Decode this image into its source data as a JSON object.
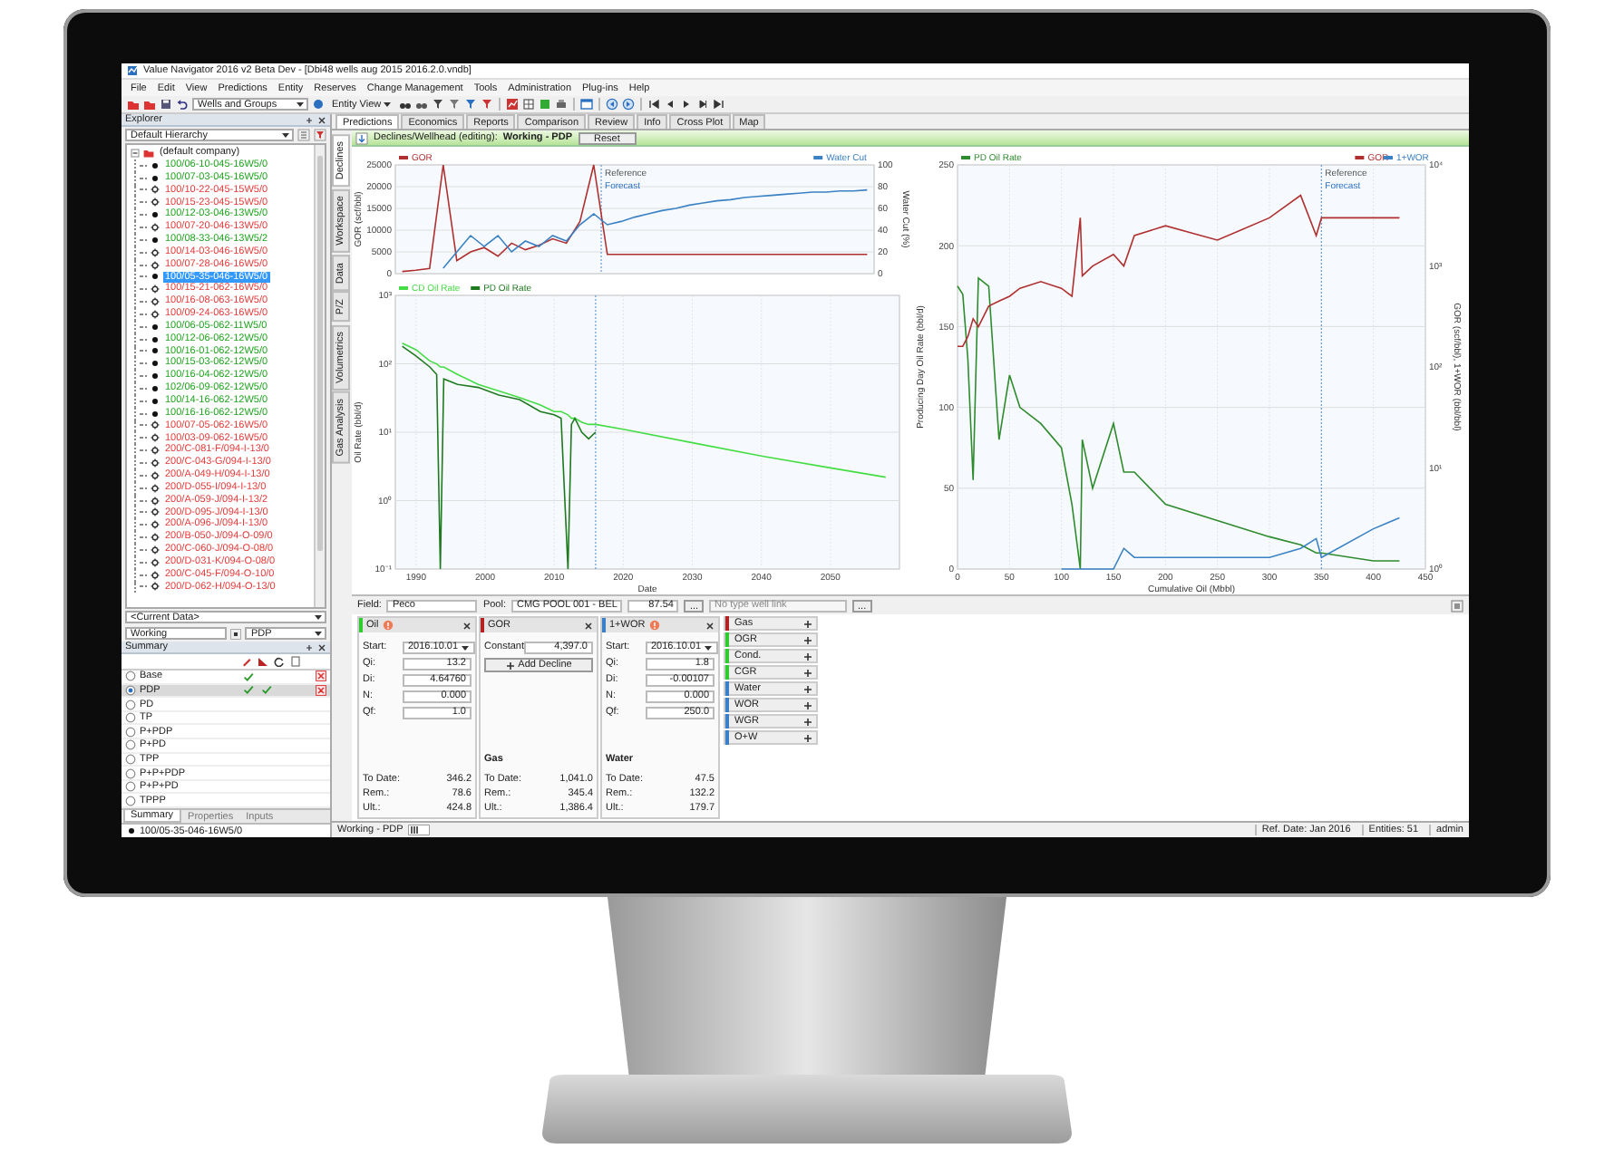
{
  "window": {
    "title": "Value Navigator 2016 v2 Beta Dev - [Dbi48 wells aug 2015 2016.2.0.vndb]"
  },
  "menu": [
    "File",
    "Edit",
    "View",
    "Predictions",
    "Entity",
    "Reserves",
    "Change Management",
    "Tools",
    "Administration",
    "Plug-ins",
    "Help"
  ],
  "toolbar": {
    "hierarchy_select": "Wells and Groups",
    "view_button": "Entity View"
  },
  "explorer": {
    "title": "Explorer",
    "hierarchy": "Default Hierarchy",
    "tree": [
      {
        "label": "(default company)",
        "expanded": true,
        "selected": false,
        "children": [
          {
            "label": "100/06-10-045-16W5/0",
            "kind": "dot",
            "color": "#1fa51f",
            "selected": false
          },
          {
            "label": "100/07-03-045-16W5/0",
            "kind": "dot",
            "color": "#1fa51f",
            "selected": false
          },
          {
            "label": "100/10-22-045-15W5/0",
            "kind": "gear",
            "color": "#e83a3a",
            "selected": false
          },
          {
            "label": "100/15-23-045-15W5/0",
            "kind": "gear",
            "color": "#e83a3a",
            "selected": false
          },
          {
            "label": "100/12-03-046-13W5/0",
            "kind": "dot",
            "color": "#1fa51f",
            "selected": false
          },
          {
            "label": "100/07-20-046-13W5/0",
            "kind": "gear",
            "color": "#e83a3a",
            "selected": false
          },
          {
            "label": "100/08-33-046-13W5/2",
            "kind": "dot",
            "color": "#1fa51f",
            "selected": false
          },
          {
            "label": "100/14-03-046-16W5/0",
            "kind": "gear",
            "color": "#e83a3a",
            "selected": false
          },
          {
            "label": "100/07-28-046-16W5/0",
            "kind": "gear",
            "color": "#e83a3a",
            "selected": false
          },
          {
            "label": "100/05-35-046-16W5/0",
            "kind": "dot",
            "selected": true
          },
          {
            "label": "100/15-21-062-16W5/0",
            "kind": "gear",
            "color": "#e83a3a",
            "selected": false
          },
          {
            "label": "100/16-08-063-16W5/0",
            "kind": "gear",
            "color": "#e83a3a",
            "selected": false
          },
          {
            "label": "100/09-24-063-16W5/0",
            "kind": "gear",
            "color": "#e83a3a",
            "selected": false
          },
          {
            "label": "100/06-05-062-11W5/0",
            "kind": "dot",
            "color": "#1fa51f",
            "selected": false
          },
          {
            "label": "100/12-06-062-12W5/0",
            "kind": "dot",
            "color": "#1fa51f",
            "selected": false
          },
          {
            "label": "100/16-01-062-12W5/0",
            "kind": "dot",
            "color": "#1fa51f",
            "selected": false
          },
          {
            "label": "100/15-03-062-12W5/0",
            "kind": "dot",
            "color": "#1fa51f",
            "selected": false
          },
          {
            "label": "100/16-04-062-12W5/0",
            "kind": "dot",
            "color": "#1fa51f",
            "selected": false
          },
          {
            "label": "102/06-09-062-12W5/0",
            "kind": "dot",
            "color": "#1fa51f",
            "selected": false
          },
          {
            "label": "100/14-16-062-12W5/0",
            "kind": "dot",
            "color": "#1fa51f",
            "selected": false
          },
          {
            "label": "100/16-16-062-12W5/0",
            "kind": "dot",
            "color": "#1fa51f",
            "selected": false
          },
          {
            "label": "100/07-05-062-16W5/0",
            "kind": "gear",
            "color": "#e83a3a",
            "selected": false
          },
          {
            "label": "100/03-09-062-16W5/0",
            "kind": "gear",
            "color": "#e83a3a",
            "selected": false
          },
          {
            "label": "200/C-081-F/094-I-13/0",
            "kind": "gear",
            "color": "#e83a3a",
            "selected": false
          },
          {
            "label": "200/C-043-G/094-I-13/0",
            "kind": "gear",
            "color": "#e83a3a",
            "selected": false
          },
          {
            "label": "200/A-049-H/094-I-13/0",
            "kind": "gear",
            "color": "#e83a3a",
            "selected": false
          },
          {
            "label": "200/D-055-I/094-I-13/0",
            "kind": "gear",
            "color": "#e83a3a",
            "selected": false
          },
          {
            "label": "200/A-059-J/094-I-13/2",
            "kind": "gear",
            "color": "#e83a3a",
            "selected": false
          },
          {
            "label": "200/D-095-J/094-I-13/0",
            "kind": "gear",
            "color": "#e83a3a",
            "selected": false
          },
          {
            "label": "200/A-096-J/094-I-13/0",
            "kind": "gear",
            "color": "#e83a3a",
            "selected": false
          },
          {
            "label": "200/B-050-J/094-O-09/0",
            "kind": "gear",
            "color": "#e83a3a",
            "selected": false
          },
          {
            "label": "200/C-060-J/094-O-08/0",
            "kind": "gear",
            "color": "#e83a3a",
            "selected": false
          },
          {
            "label": "200/D-031-K/094-O-08/0",
            "kind": "gear",
            "color": "#e83a3a",
            "selected": false
          },
          {
            "label": "200/C-045-F/094-O-10/0",
            "kind": "gear",
            "color": "#e83a3a",
            "selected": false
          },
          {
            "label": "200/D-062-H/094-O-13/0",
            "kind": "gear",
            "color": "#e83a3a",
            "selected": false
          }
        ]
      }
    ],
    "data_select": "<Current Data>",
    "scenario": "Working",
    "scenario_type": "PDP"
  },
  "summary": {
    "title": "Summary",
    "rows": [
      {
        "name": "Base",
        "selected": false,
        "check_1": true,
        "check_2": false,
        "removable": true
      },
      {
        "name": "PDP",
        "selected": true,
        "check_1": true,
        "check_2": true,
        "removable": true
      },
      {
        "name": "PD",
        "selected": false,
        "check_1": false,
        "check_2": false,
        "removable": false
      },
      {
        "name": "TP",
        "selected": false,
        "check_1": false,
        "check_2": false,
        "removable": false
      },
      {
        "name": "P+PDP",
        "selected": false,
        "check_1": false,
        "check_2": false,
        "removable": false
      },
      {
        "name": "P+PD",
        "selected": false,
        "check_1": false,
        "check_2": false,
        "removable": false
      },
      {
        "name": "TPP",
        "selected": false,
        "check_1": false,
        "check_2": false,
        "removable": false
      },
      {
        "name": "P+P+PDP",
        "selected": false,
        "check_1": false,
        "check_2": false,
        "removable": false
      },
      {
        "name": "P+P+PD",
        "selected": false,
        "check_1": false,
        "check_2": false,
        "removable": false
      },
      {
        "name": "TPPP",
        "selected": false,
        "check_1": false,
        "check_2": false,
        "removable": false
      }
    ],
    "tabs": [
      {
        "label": "Summary",
        "selected": true
      },
      {
        "label": "Properties",
        "selected": false
      },
      {
        "label": "Inputs",
        "selected": false
      }
    ],
    "entity": "100/05-35-046-16W5/0"
  },
  "main": {
    "tabs": [
      {
        "label": "Predictions",
        "selected": true
      },
      {
        "label": "Economics",
        "selected": false
      },
      {
        "label": "Reports",
        "selected": false
      },
      {
        "label": "Comparison",
        "selected": false
      },
      {
        "label": "Review",
        "selected": false
      },
      {
        "label": "Info",
        "selected": false
      },
      {
        "label": "Cross Plot",
        "selected": false
      },
      {
        "label": "Map",
        "selected": false
      }
    ],
    "side_tabs": [
      {
        "label": "Declines",
        "selected": true
      },
      {
        "label": "Workspace",
        "selected": false
      },
      {
        "label": "Data",
        "selected": false
      },
      {
        "label": "P/Z",
        "selected": false
      },
      {
        "label": "Volumetrics",
        "selected": false
      },
      {
        "label": "Gas Analysis",
        "selected": false
      }
    ],
    "edit_bar": {
      "label": "Declines/Wellhead (editing):",
      "scenario": "Working - PDP",
      "button": "Reset"
    },
    "charts": [
      {
        "chart_data": {
          "type": "line",
          "grid": true,
          "legend": "top",
          "ylabel": "GOR (scf/bbl)",
          "y2label": "Water Cut (%)",
          "ylim": [
            0,
            25000
          ],
          "yticks": [
            0,
            5000,
            10000,
            15000,
            20000,
            25000
          ],
          "y2lim": [
            0,
            100
          ],
          "y2ticks": [
            0,
            20,
            40,
            60,
            80,
            100
          ],
          "categories": [
            null,
            null,
            null,
            null,
            null,
            null,
            null,
            null,
            null,
            null,
            null,
            null,
            null,
            null,
            null,
            null,
            null,
            null,
            null,
            null,
            null,
            null,
            null,
            null,
            null,
            null,
            null,
            null,
            null,
            null,
            null,
            null,
            null,
            null,
            null
          ],
          "series": [
            {
              "name": "GOR",
              "color": "#b03030",
              "values": [
                500,
                800,
                1200,
                25000,
                3000,
                5000,
                6000,
                4000,
                7000,
                5500,
                6500,
                8000,
                7000,
                12000,
                25000,
                4400,
                4400,
                4400,
                4400,
                4400,
                4400,
                4400,
                4400,
                4400,
                4400,
                4400,
                4400,
                4400,
                4400,
                4400,
                4400,
                4400,
                4400,
                4400,
                4400
              ]
            },
            {
              "name": "Water Cut",
              "color": "#3b82c4",
              "axis": "y2",
              "values": [
                null,
                null,
                null,
                5,
                20,
                35,
                25,
                35,
                20,
                30,
                25,
                35,
                30,
                45,
                55,
                45,
                48,
                52,
                55,
                58,
                60,
                63,
                65,
                67,
                68,
                70,
                71,
                72,
                73,
                74,
                75,
                75,
                76,
                76,
                77
              ]
            }
          ],
          "annotations": [
            "Reference",
            "Forecast"
          ]
        }
      },
      {
        "chart_data": {
          "type": "line",
          "grid": true,
          "legend": "top",
          "log": "y",
          "xlabel": "Date",
          "ylabel": "Oil Rate (bbl/d)",
          "xlim": [
            1987,
            2060
          ],
          "ylim": [
            0.1,
            1000
          ],
          "xticks": [
            1990,
            2000,
            2010,
            2020,
            2030,
            2040,
            2050
          ],
          "yticks": [
            {
              "value": 0.1,
              "label": "10⁻¹"
            },
            {
              "value": 1,
              "label": "10⁰"
            },
            {
              "value": 10,
              "label": "10¹"
            },
            {
              "value": 100,
              "label": "10²"
            },
            {
              "value": 1000,
              "label": "10³"
            }
          ],
          "x": [
            1988,
            1990,
            1992,
            1993,
            1993.5,
            1994,
            1996,
            1999,
            2002,
            2005,
            2008,
            2010,
            2011,
            2012,
            2012.5,
            2013,
            2014,
            2015,
            2016,
            2020,
            2030,
            2040,
            2050,
            2058
          ],
          "series": [
            {
              "name": "CD Oil Rate",
              "color": "#44dd44",
              "values": [
                200,
                160,
                110,
                100,
                90,
                90,
                70,
                50,
                40,
                32,
                25,
                20,
                20,
                18,
                16,
                16,
                14,
                13,
                13,
                11,
                7,
                4.5,
                3,
                2.2
              ]
            },
            {
              "name": "PD Oil Rate",
              "color": "#1f7a1f",
              "values": [
                180,
                130,
                90,
                70,
                0.1,
                60,
                50,
                45,
                35,
                30,
                20,
                18,
                16,
                0.1,
                13,
                16,
                10,
                8,
                10,
                null,
                null,
                null,
                null,
                null
              ]
            }
          ],
          "ref_lines": [
            {
              "axis": "x",
              "value": 2016
            }
          ]
        }
      },
      {
        "chart_data": {
          "type": "line",
          "grid": true,
          "legend": "top",
          "log": "y2",
          "xlabel": "Cumulative Oil (Mbbl)",
          "ylabel": "Producing Day Oil Rate (bbl/d)",
          "y2label": "GOR (scf/bbl), 1+WOR (bbl/bbl)",
          "xlim": [
            0,
            450
          ],
          "ylim": [
            0,
            250
          ],
          "xticks": [
            0,
            50,
            100,
            150,
            200,
            250,
            300,
            350,
            400,
            450
          ],
          "yticks": [
            0,
            50,
            100,
            150,
            200,
            250
          ],
          "y2lim": [
            1,
            10000
          ],
          "y2ticks": [
            {
              "value": 1,
              "label": "10⁰"
            },
            {
              "value": 10,
              "label": "10¹"
            },
            {
              "value": 100,
              "label": "10²"
            },
            {
              "value": 1000,
              "label": "10³"
            },
            {
              "value": 10000,
              "label": "10⁴"
            }
          ],
          "x": [
            0,
            5,
            10,
            15,
            20,
            30,
            40,
            50,
            60,
            80,
            100,
            110,
            118,
            120,
            130,
            150,
            160,
            170,
            200,
            250,
            300,
            330,
            345,
            350,
            400,
            425
          ],
          "series": [
            {
              "name": "PD Oil Rate",
              "color": "#2e8b2e",
              "values": [
                175,
                170,
                130,
                55,
                180,
                175,
                80,
                120,
                100,
                90,
                75,
                40,
                0,
                80,
                50,
                90,
                60,
                60,
                40,
                30,
                20,
                15,
                10,
                10,
                5,
                5
              ]
            },
            {
              "name": "GOR",
              "color": "#b03030",
              "axis": "y2",
              "values": [
                160,
                160,
                200,
                300,
                250,
                400,
                450,
                500,
                600,
                700,
                600,
                500,
                3000,
                800,
                1000,
                1300,
                1000,
                2000,
                2500,
                1800,
                3000,
                5000,
                2000,
                3000,
                3000,
                3000
              ]
            },
            {
              "name": "1+WOR",
              "color": "#3b82c4",
              "axis": "y2",
              "values": [
                null,
                null,
                null,
                null,
                null,
                null,
                null,
                null,
                null,
                null,
                1,
                1,
                1,
                1,
                1,
                1,
                1.6,
                1.3,
                1.3,
                1.3,
                1.3,
                1.6,
                2,
                1.3,
                2.5,
                3.2
              ]
            }
          ],
          "ref_lines": [
            {
              "axis": "x",
              "value": 350
            }
          ],
          "annotations": [
            "Reference",
            "Forecast"
          ]
        }
      }
    ],
    "editor": {
      "field_label": "Field:",
      "field": "Peco",
      "pool_label": "Pool:",
      "pool": "CMG POOL 001 - BEL",
      "pool_value": "87.54",
      "pool_button": "...",
      "type_well": {
        "placeholder": "No type well link"
      },
      "type_well_button": "...",
      "cards": [
        {
          "name": "Oil",
          "color": "#2ecc2e",
          "warning": true,
          "params": [
            {
              "label": "Start:",
              "value": "2016.10.01",
              "kind": "select"
            },
            {
              "label": "Qi:",
              "value": "13.2",
              "kind": "input"
            },
            {
              "label": "Di:",
              "value": "4.64760",
              "kind": "input"
            },
            {
              "label": "N:",
              "value": "0.000",
              "kind": "input"
            },
            {
              "label": "Qf:",
              "value": "1.0",
              "kind": "input"
            }
          ],
          "totals": [
            {
              "label": "To Date:",
              "value": "346.2"
            },
            {
              "label": "Rem.:",
              "value": "78.6"
            },
            {
              "label": "Ult.:",
              "value": "424.8"
            }
          ]
        },
        {
          "name": "GOR",
          "color": "#b22222",
          "warning": false,
          "params": [
            {
              "label": "Constant:",
              "value": "4,397.0",
              "kind": "input"
            }
          ],
          "action": "Add Decline",
          "totals_title": "Gas",
          "totals": [
            {
              "label": "To Date:",
              "value": "1,041.0"
            },
            {
              "label": "Rem.:",
              "value": "345.4"
            },
            {
              "label": "Ult.:",
              "value": "1,386.4"
            }
          ]
        },
        {
          "name": "1+WOR",
          "color": "#3a7fc8",
          "warning": true,
          "params": [
            {
              "label": "Start:",
              "value": "2016.10.01",
              "kind": "select"
            },
            {
              "label": "Qi:",
              "value": "1.8",
              "kind": "input"
            },
            {
              "label": "Di:",
              "value": "-0.00107",
              "kind": "input"
            },
            {
              "label": "N:",
              "value": "0.000",
              "kind": "input"
            },
            {
              "label": "Qf:",
              "value": "250.0",
              "kind": "input"
            }
          ],
          "totals_title": "Water",
          "totals": [
            {
              "label": "To Date:",
              "value": "47.5"
            },
            {
              "label": "Rem.:",
              "value": "132.2"
            },
            {
              "label": "Ult.:",
              "value": "179.7"
            }
          ]
        }
      ],
      "products": [
        {
          "name": "Gas",
          "color": "#b22222"
        },
        {
          "name": "OGR",
          "color": "#2ecc2e"
        },
        {
          "name": "Cond.",
          "color": "#2ecc2e"
        },
        {
          "name": "CGR",
          "color": "#2ecc2e"
        },
        {
          "name": "Water",
          "color": "#3a7fc8"
        },
        {
          "name": "WOR",
          "color": "#3a7fc8"
        },
        {
          "name": "WGR",
          "color": "#3a7fc8"
        },
        {
          "name": "O+W",
          "color": "#3a7fc8"
        }
      ]
    },
    "status": {
      "scenario": "Working - PDP",
      "ref_date": "Ref. Date: Jan 2016",
      "entities": "Entities: 51",
      "user": "admin"
    }
  }
}
